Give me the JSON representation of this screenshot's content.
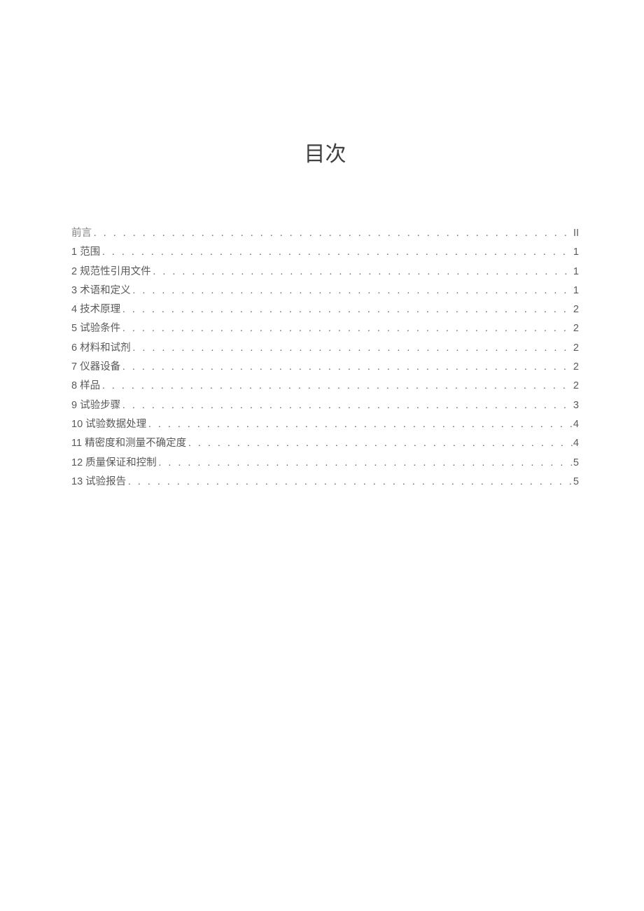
{
  "title": "目次",
  "entries": [
    {
      "label": "前言",
      "page": "II",
      "isPreface": true
    },
    {
      "label": "1 范围",
      "page": "1",
      "isPreface": false
    },
    {
      "label": "2 规范性引用文件",
      "page": "1",
      "isPreface": false
    },
    {
      "label": "3 术语和定义",
      "page": "1",
      "isPreface": false
    },
    {
      "label": "4 技术原理",
      "page": "2",
      "isPreface": false
    },
    {
      "label": "5 试验条件",
      "page": "2",
      "isPreface": false
    },
    {
      "label": "6 材料和试剂",
      "page": "2",
      "isPreface": false
    },
    {
      "label": "7 仪器设备",
      "page": "2",
      "isPreface": false
    },
    {
      "label": "8 样品",
      "page": "2",
      "isPreface": false
    },
    {
      "label": "9 试验步骤",
      "page": "3",
      "isPreface": false
    },
    {
      "label": "10 试验数据处理",
      "page": "4",
      "isPreface": false
    },
    {
      "label": "11 精密度和测量不确定度",
      "page": "4",
      "isPreface": false
    },
    {
      "label": "12 质量保证和控制",
      "page": "5",
      "isPreface": false
    },
    {
      "label": "13 试验报告",
      "page": "5",
      "isPreface": false
    }
  ]
}
